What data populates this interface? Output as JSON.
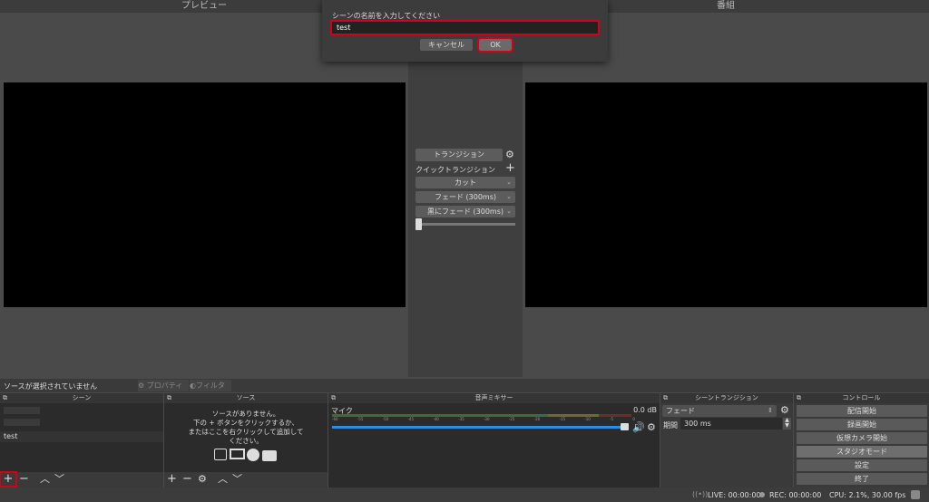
{
  "preview_header": "プレビュー",
  "program_header": "番組",
  "dialog": {
    "prompt": "シーンの名前を入力してください",
    "input_value": "test",
    "cancel": "キャンセル",
    "ok": "OK"
  },
  "transition_panel": {
    "transition_button": "トランジション",
    "quick_transition": "クイックトランジション",
    "options": [
      "カット",
      "フェード (300ms)",
      "黒にフェード (300ms)"
    ]
  },
  "source_bar": {
    "status": "ソースが選択されていません",
    "properties": "プロパティ",
    "filters": "フィルタ"
  },
  "docks": {
    "scenes": {
      "title": "シーン",
      "items": [
        "test"
      ]
    },
    "sources": {
      "title": "ソース",
      "empty_message": "ソースがありません。\n下の + ボタンをクリックするか、\nまたはここを右クリックして追加して\nください。"
    },
    "mixer": {
      "title": "音声ミキサー",
      "channel": "マイク",
      "level": "0.0 dB",
      "ticks": [
        "-60",
        "-55",
        "-50",
        "-45",
        "-40",
        "-35",
        "-30",
        "-25",
        "-20",
        "-15",
        "-10",
        "-5",
        "0"
      ]
    },
    "scene_transitions": {
      "title": "シーントランジション",
      "selected": "フェード",
      "duration_label": "期間",
      "duration_value": "300 ms"
    },
    "controls": {
      "title": "コントロール",
      "buttons": [
        "配信開始",
        "録画開始",
        "仮想カメラ開始",
        "スタジオモード",
        "設定",
        "終了"
      ]
    }
  },
  "status_bar": {
    "live": "LIVE: 00:00:00",
    "rec": "REC: 00:00:00",
    "cpu": "CPU: 2.1%, 30.00 fps"
  },
  "colors": {
    "highlight": "#d0021b",
    "meter_green": "#4caf50",
    "meter_yellow": "#c8b400",
    "volume_blue": "#2d8ce6"
  }
}
